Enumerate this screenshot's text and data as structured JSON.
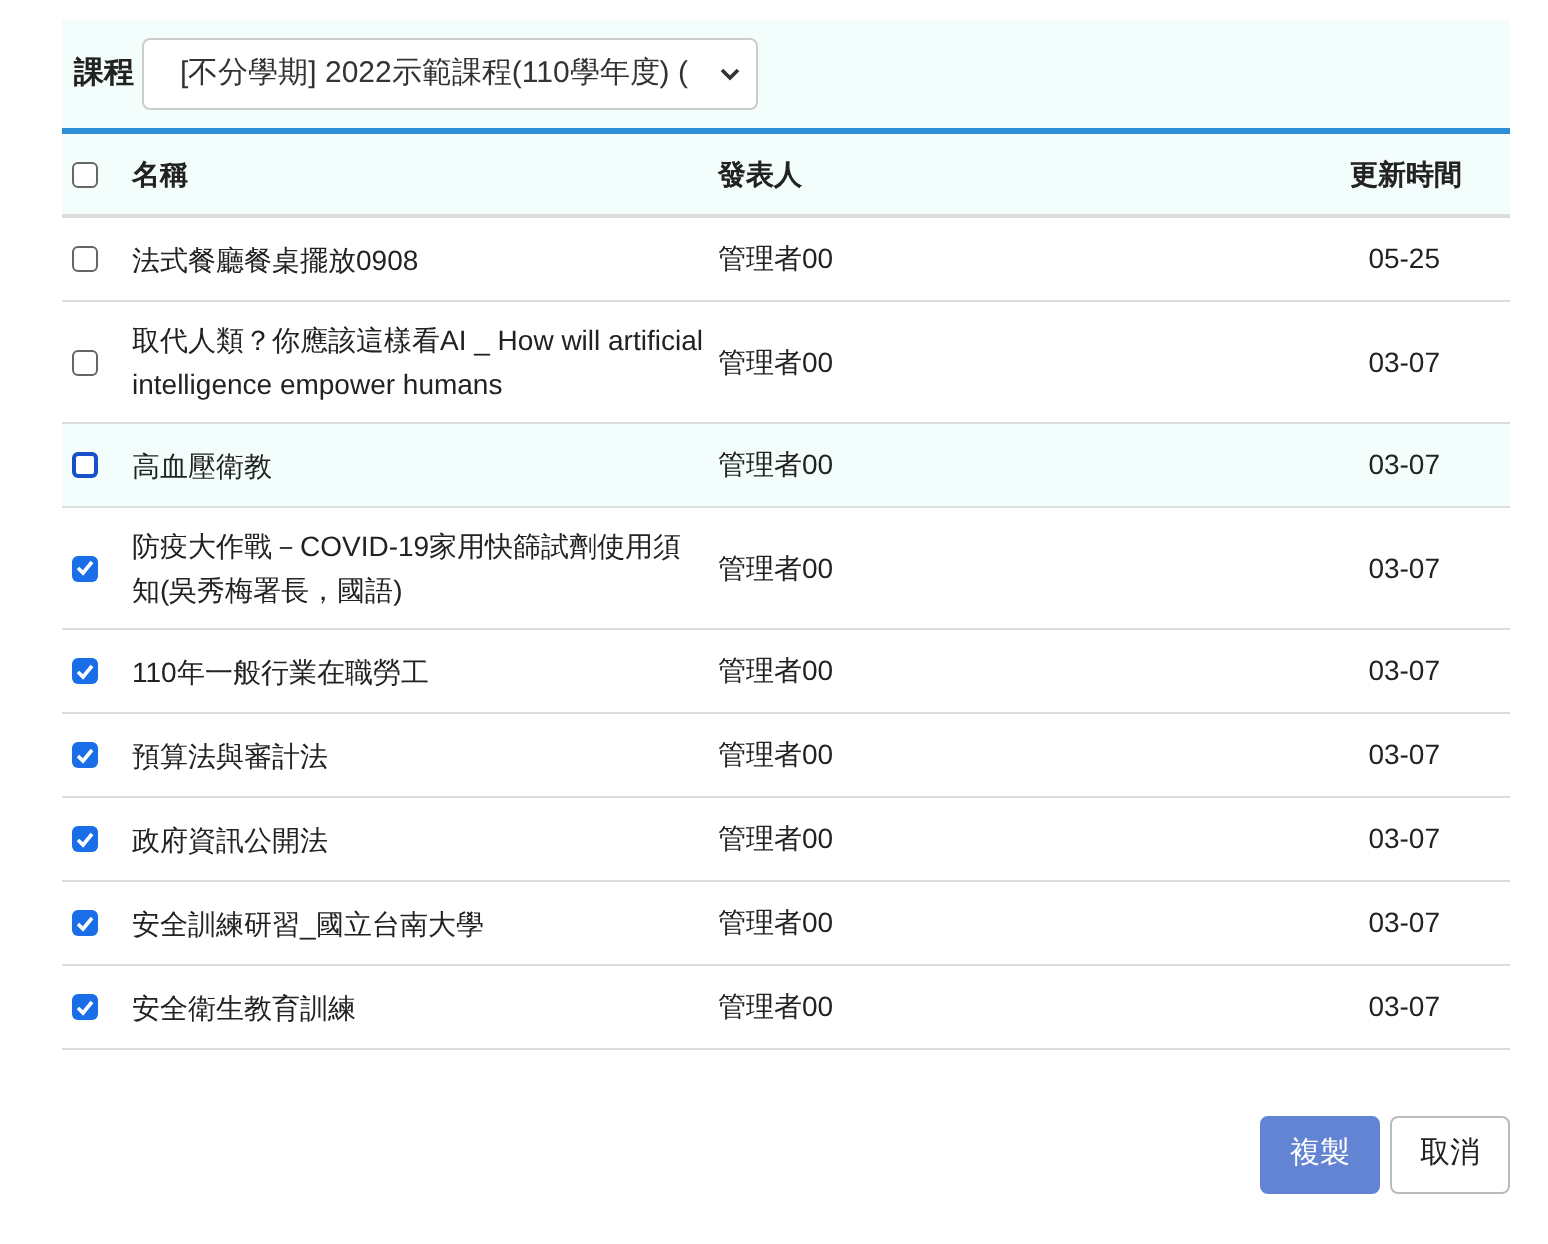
{
  "filter": {
    "label": "課程",
    "course_select": "[不分學期] 2022示範課程(110學年度) ("
  },
  "table": {
    "select_all_checked": false,
    "columns": [
      "名稱",
      "發表人",
      "更新時間"
    ],
    "rows": [
      {
        "checked": false,
        "highlighted": false,
        "name": "法式餐廳餐桌擺放0908",
        "author": "管理者00",
        "updated": "05-25"
      },
      {
        "checked": false,
        "highlighted": false,
        "name": "取代人類？你應該這樣看AI _ How will artificial intelligence empower humans",
        "author": "管理者00",
        "updated": "03-07"
      },
      {
        "checked": false,
        "highlighted": true,
        "name": "高血壓衛教",
        "author": "管理者00",
        "updated": "03-07"
      },
      {
        "checked": true,
        "highlighted": false,
        "name": "防疫大作戰－COVID-19家用快篩試劑使用須知(吳秀梅署長，國語)",
        "author": "管理者00",
        "updated": "03-07"
      },
      {
        "checked": true,
        "highlighted": false,
        "name": "110年一般行業在職勞工",
        "author": "管理者00",
        "updated": "03-07"
      },
      {
        "checked": true,
        "highlighted": false,
        "name": "預算法與審計法",
        "author": "管理者00",
        "updated": "03-07"
      },
      {
        "checked": true,
        "highlighted": false,
        "name": "政府資訊公開法",
        "author": "管理者00",
        "updated": "03-07"
      },
      {
        "checked": true,
        "highlighted": false,
        "name": "安全訓練研習_國立台南大學",
        "author": "管理者00",
        "updated": "03-07"
      },
      {
        "checked": true,
        "highlighted": false,
        "name": "安全衛生教育訓練",
        "author": "管理者00",
        "updated": "03-07"
      }
    ]
  },
  "buttons": [
    "複製",
    "取消"
  ]
}
